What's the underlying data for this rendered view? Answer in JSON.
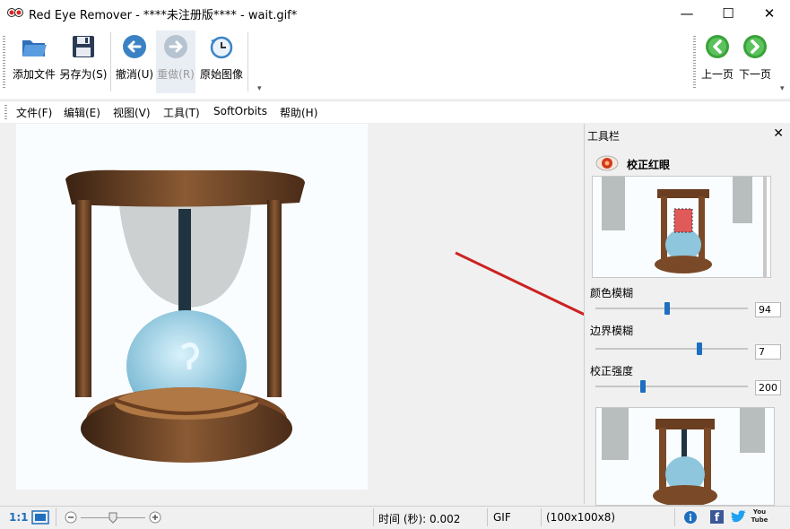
{
  "window": {
    "title": "Red Eye Remover - ****未注册版**** - wait.gif*",
    "minimize": "—",
    "maximize": "☐",
    "close": "✕"
  },
  "toolbar": {
    "add_file": "添加文件",
    "save_as": "另存为(S)",
    "undo": "撤消(U)",
    "redo": "重做(R)",
    "original": "原始图像",
    "prev_page": "上一页",
    "next_page": "下一页",
    "overflow": "▾"
  },
  "menu": {
    "items": [
      "文件(F)",
      "编辑(E)",
      "视图(V)",
      "工具(T)",
      "SoftOrbits",
      "帮助(H)"
    ]
  },
  "panel": {
    "title": "工具栏",
    "close": "✕",
    "tool_name": "校正红眼",
    "sliders": [
      {
        "label": "颜色模糊",
        "value": "94",
        "fraction": 0.47
      },
      {
        "label": "边界模糊",
        "value": "7",
        "fraction": 0.68
      },
      {
        "label": "校正强度",
        "value": "200",
        "fraction": 0.31
      }
    ]
  },
  "status": {
    "zoom_ratio": "1:1",
    "time": "时间 (秒): 0.002",
    "format": "GIF",
    "dimensions": "(100x100x8)",
    "zoom_fraction": 0.5,
    "youtube_label": "You Tube",
    "facebook_label": "f"
  },
  "colors": {
    "accent": "#1e6fc0",
    "arrow": "#cc2222",
    "nav_green": "#3aa23a",
    "undo_blue": "#3b82c4"
  }
}
